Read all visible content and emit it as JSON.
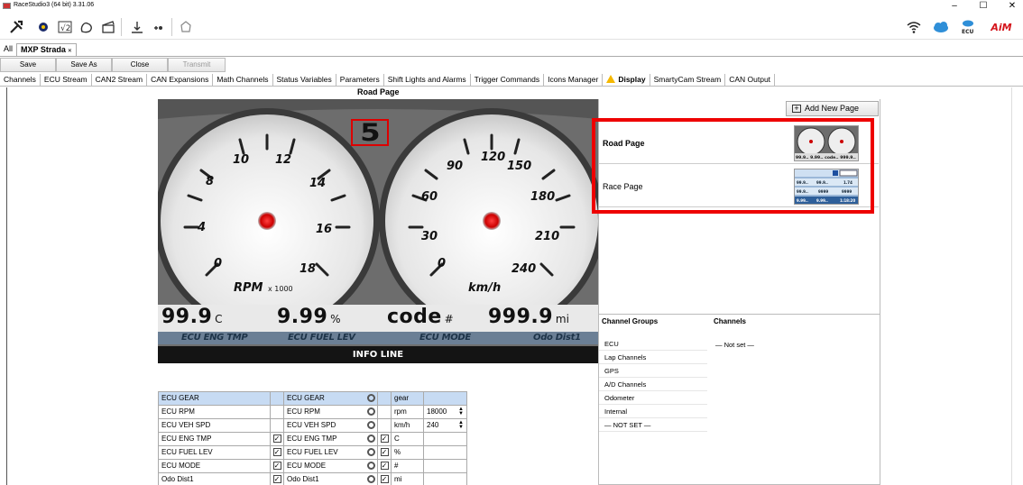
{
  "window": {
    "title": "RaceStudio3 (64 bit) 3.31.06",
    "controls": [
      "–",
      "☐",
      "✕"
    ]
  },
  "toolbar": {
    "icons": [
      "tools-icon",
      "gear-settings-icon",
      "math-channel-icon",
      "track-icon",
      "clapperboard-icon",
      "download-icon",
      "wireless-icon",
      "clock-icon"
    ],
    "right_icons": [
      "wifi-icon",
      "cloud-icon",
      "ecu-icon"
    ],
    "ecu_label": "ECU",
    "logo": "AiM"
  },
  "doc_tabs": {
    "all": "All",
    "active": "MXP Strada",
    "close": "✕"
  },
  "actions": {
    "save": "Save",
    "save_as": "Save As",
    "close": "Close",
    "transmit": "Transmit"
  },
  "main_tabs": [
    "Channels",
    "ECU Stream",
    "CAN2 Stream",
    "CAN Expansions",
    "Math Channels",
    "Status Variables",
    "Parameters",
    "Shift Lights and Alarms",
    "Trigger Commands",
    "Icons Manager",
    "Display",
    "SmartyCam Stream",
    "CAN Output"
  ],
  "active_tab": "Display",
  "page_heading": "Road Page",
  "dashboard": {
    "gear": "5",
    "rpm_gauge": {
      "ticks": [
        "0",
        "4",
        "8",
        "10",
        "12",
        "14",
        "16",
        "18"
      ],
      "unit": "RPM",
      "multiplier": "x 1000"
    },
    "speed_gauge": {
      "ticks": [
        "0",
        "30",
        "60",
        "90",
        "120",
        "150",
        "180",
        "210",
        "240"
      ],
      "unit": "km/h"
    },
    "readouts": [
      {
        "value": "99.9",
        "unit": "C"
      },
      {
        "value": "9.99",
        "unit": "%"
      },
      {
        "value": "code",
        "unit": "#"
      },
      {
        "value": "999.9",
        "unit": "mi"
      }
    ],
    "labels": [
      "ECU ENG TMP",
      "ECU FUEL LEV",
      "ECU MODE",
      "Odo Dist1"
    ],
    "info_line": "INFO LINE"
  },
  "config_rows": [
    {
      "source": "ECU GEAR",
      "checked": false,
      "channel": "ECU GEAR",
      "unit_checked": false,
      "unit": "gear",
      "max": ""
    },
    {
      "source": "ECU RPM",
      "checked": false,
      "channel": "ECU RPM",
      "unit_checked": false,
      "unit": "rpm",
      "max": "18000"
    },
    {
      "source": "ECU VEH SPD",
      "checked": false,
      "channel": "ECU VEH SPD",
      "unit_checked": false,
      "unit": "km/h",
      "max": "240"
    },
    {
      "source": "ECU ENG TMP",
      "checked": true,
      "channel": "ECU ENG TMP",
      "unit_checked": true,
      "unit": "C",
      "max": ""
    },
    {
      "source": "ECU FUEL LEV",
      "checked": true,
      "channel": "ECU FUEL LEV",
      "unit_checked": true,
      "unit": "%",
      "max": ""
    },
    {
      "source": "ECU MODE",
      "checked": true,
      "channel": "ECU MODE",
      "unit_checked": true,
      "unit": "#",
      "max": ""
    },
    {
      "source": "Odo Dist1",
      "checked": true,
      "channel": "Odo Dist1",
      "unit_checked": true,
      "unit": "mi",
      "max": ""
    }
  ],
  "right_panel": {
    "add_button": "Add New Page",
    "pages": [
      {
        "name": "Road Page",
        "selected": true
      },
      {
        "name": "Race Page",
        "selected": false
      }
    ],
    "thumb_road_text": "99.9.. 9.99.. code.. 999.9..",
    "thumb_race_text": [
      "99.9..",
      "99.9..",
      "1.74",
      "99.9..",
      "9999",
      "9999",
      "9.99..",
      "9.99..",
      "1:18:20"
    ],
    "channel_groups_header": "Channel Groups",
    "channels_header": "Channels",
    "channel_groups": [
      "ECU",
      "Lap Channels",
      "GPS",
      "A/D Channels",
      "Odometer",
      "Internal",
      "— NOT SET —"
    ],
    "channels_value": "— Not set —"
  }
}
